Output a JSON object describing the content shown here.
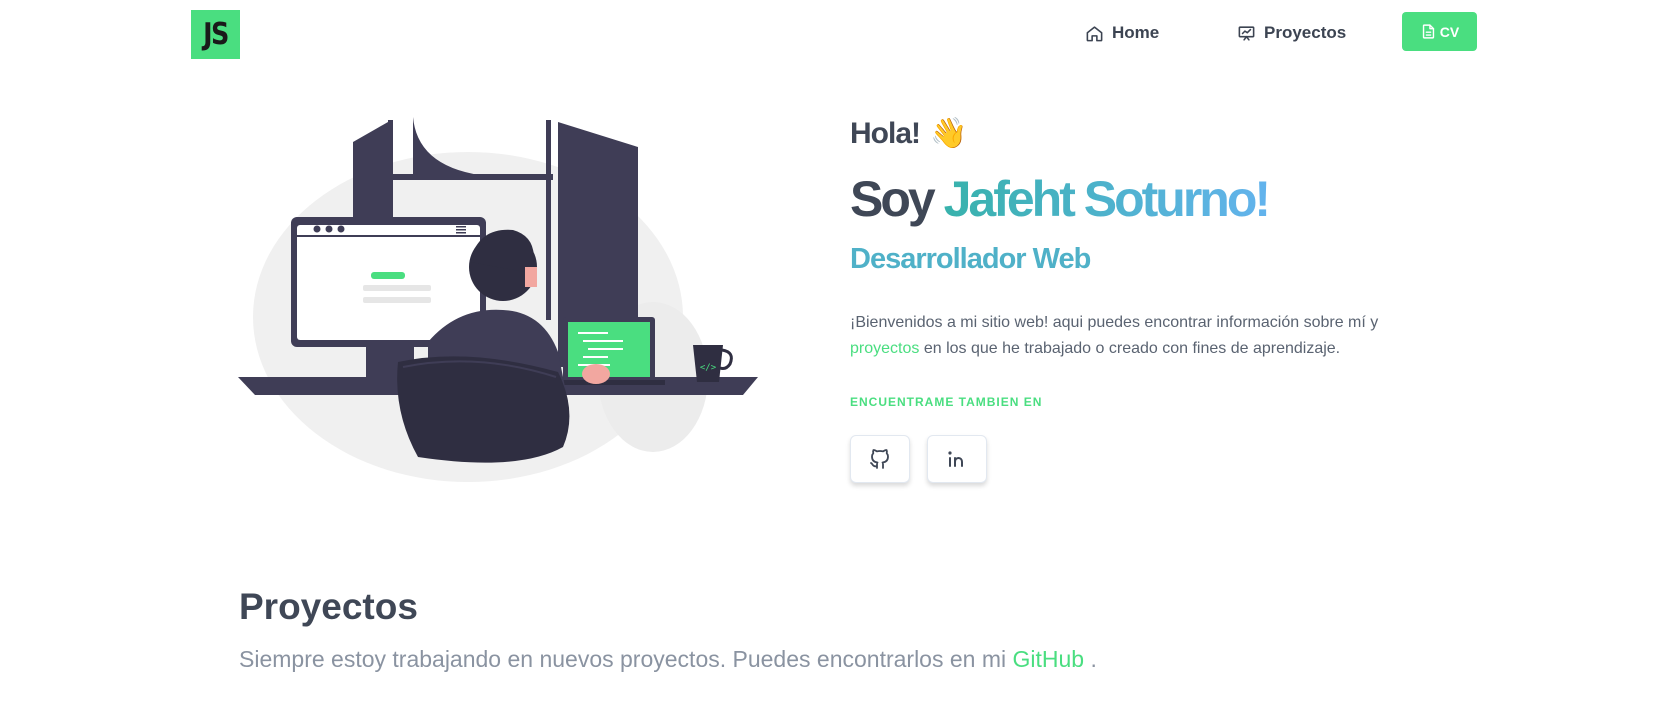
{
  "header": {
    "logo_text": "JS",
    "nav": [
      {
        "label": "Home",
        "icon": "home-icon"
      },
      {
        "label": "Proyectos",
        "icon": "presentation-chart-icon"
      }
    ],
    "cv_label": "CV",
    "cv_icon": "document-icon"
  },
  "hero": {
    "greeting": "Hola!",
    "greeting_emoji": "👋",
    "intro_prefix": "Soy",
    "name": "Jafeht Soturno!",
    "role": "Desarrollador Web",
    "welcome_text_1": "¡Bienvenidos a mi sitio web! aqui puedes encontrar información sobre mí y",
    "welcome_link": "proyectos",
    "welcome_text_2": "en los que he trabajado o creado con fines de aprendizaje.",
    "find_me_label": "ENCUENTRAME TAMBIEN EN",
    "social": [
      {
        "icon": "github-icon"
      },
      {
        "icon": "linkedin-icon"
      }
    ]
  },
  "projects": {
    "title": "Proyectos",
    "subtitle_prefix": "Siempre estoy trabajando en nuevos proyectos. Puedes encontrarlos en mi",
    "subtitle_link": "GitHub",
    "subtitle_suffix": "."
  },
  "colors": {
    "accent": "#4ade80",
    "text_dark": "#3f4756",
    "name_gradient_start": "#38b2ac",
    "name_gradient_end": "#63b3ed"
  }
}
